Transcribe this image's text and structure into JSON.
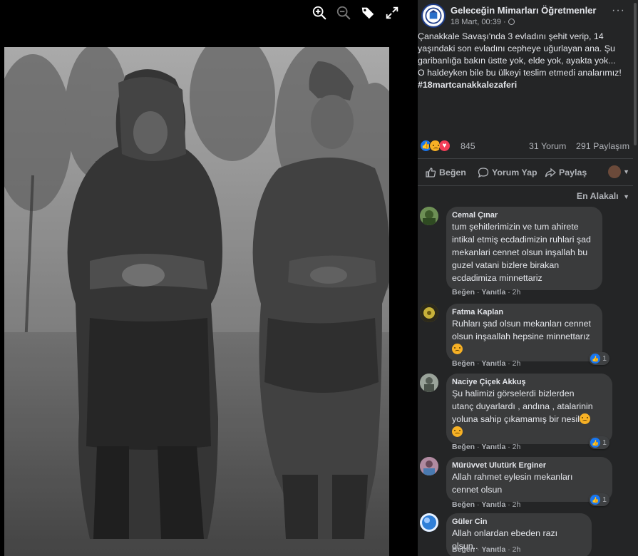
{
  "viewer": {
    "tools": [
      {
        "name": "zoom-in-icon"
      },
      {
        "name": "zoom-out-icon"
      },
      {
        "name": "tag-icon"
      },
      {
        "name": "fullscreen-icon"
      }
    ]
  },
  "post": {
    "page_name": "Geleceğin Mimarları Öğretmenler",
    "time": "18 Mart, 00:39 ·",
    "more": "···",
    "text_lines": [
      "Çanakkale Savaşı'nda 3 evladını şehit verip, 14 yaşındaki son evladını cepheye uğurlayan ana. Şu garibanlığa bakın üstte yok, elde yok, ayakta yok...",
      "O haldeyken bile bu ülkeyi teslim etmedi analarımız!"
    ],
    "hashtag": "#18martcanakkalezaferi",
    "reaction_count": "845",
    "comment_count": "31 Yorum",
    "share_count": "291 Paylaşım",
    "actions": {
      "like": "Beğen",
      "comment": "Yorum Yap",
      "share": "Paylaş"
    },
    "sort_label": "En Alakalı"
  },
  "comments": [
    {
      "author": "Cemal Çınar",
      "lines": [
        "tum şehitlerimizin ve tum ahirete",
        "intikal etmiş ecdadimizin ruhlari şad",
        "mekanlari cennet olsun inşallah bu",
        "guzel vatani bizlere birakan",
        "ecdadimiza minnettariz"
      ],
      "like": "Beğen",
      "reply": "Yanıtla",
      "age": "2h",
      "reactions": null,
      "avatar_color": "#4a6b3a"
    },
    {
      "author": "Fatma Kaplan",
      "lines": [
        "Ruhları şad olsun mekanları cennet",
        "olsun inşaallah hepsine minnettarız"
      ],
      "sad_emoji": true,
      "like": "Beğen",
      "reply": "Yanıtla",
      "age": "2h",
      "reactions": "1",
      "avatar_color": "#8a7a2a"
    },
    {
      "author": "Naciye Çiçek Akkuş",
      "lines": [
        "Şu halimizi görselerdi bizlerden",
        "utanç duyarlardı , andına , atalarinin",
        "yoluna sahip çıkamamış bir nesil"
      ],
      "sad_emoji_inline": true,
      "sad_emoji": true,
      "like": "Beğen",
      "reply": "Yanıtla",
      "age": "2h",
      "reactions": "1",
      "avatar_color": "#6f7a6a"
    },
    {
      "author": "Mürüvvet Ulutürk Erginer",
      "lines": [
        "Allah rahmet eylesin mekanları",
        "cennet olsun"
      ],
      "like": "Beğen",
      "reply": "Yanıtla",
      "age": "2h",
      "reactions": "1",
      "avatar_color": "#8a6a7a"
    },
    {
      "author": "Güler Cin",
      "lines": [
        "Allah onlardan ebeden razı olsun.."
      ],
      "like": "Beğen",
      "reply": "Yanıtla",
      "age": "2h",
      "reactions": null,
      "avatar_color": "#2f7fd8"
    }
  ],
  "colors": {
    "sidebar_bg": "#242526",
    "bubble_bg": "#3a3b3c",
    "text_primary": "#e4e6eb",
    "text_secondary": "#b0b3b8",
    "like_blue": "#1877f2"
  }
}
